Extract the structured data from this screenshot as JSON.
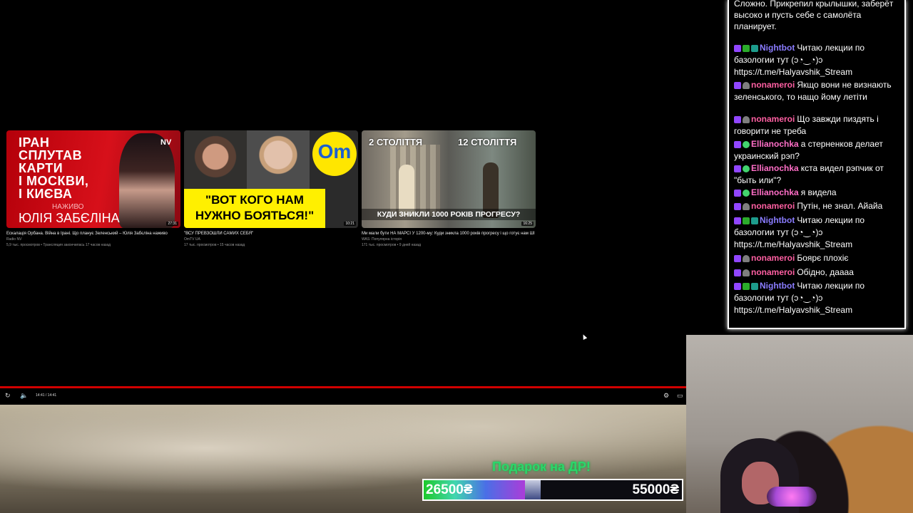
{
  "videos": [
    {
      "thumb_headline": "ІРАН\nСПЛУТАВ\nКАРТИ\nІ МОСКВИ,\nІ КИЄВА",
      "thumb_live": "НАЖИВО",
      "thumb_name": "ЮЛІЯ ЗАБЄЛІНА",
      "thumb_badge": "NV",
      "duration": "27:31",
      "title": "Ескалація Орбана. Війна в Ірані. Що планує Зеленський – Юлія Забєліна наживо",
      "channel": "Radio NV",
      "meta": "5,9 тыс. просмотров • Трансляция закончилась 17 часов назад"
    },
    {
      "thumb_logo": "Om",
      "thumb_quote": "\"ВОТ КОГО НАМ\nНУЖНО БОЯТЬСЯ!\"",
      "duration": "10:21",
      "title": "\"ВСУ ПРЕВЗОШЛИ САМИХ СЕБЯ\"",
      "channel": "OmTV UA",
      "meta": "17 тыс. просмотров • 15 часов назад"
    },
    {
      "thumb_left": "2 СТОЛІТТЯ",
      "thumb_right": "12 СТОЛІТТЯ",
      "thumb_bottom": "КУДИ ЗНИКЛИ 1000 РОКІВ ПРОГРЕСУ?",
      "duration": "16:25",
      "title": "Ми мали бути НА МАРСІ У 1200-му: Куди зникла 1000 років прогресу і що готує нам ШІ",
      "channel": "WAS: Популярна історія",
      "meta": "171 тыс. просмотров • 9 дней назад"
    }
  ],
  "player": {
    "time": "14:41 / 14:41",
    "progress_fraction": 1.0
  },
  "donation_goal": {
    "title": "Подарок на ДР!",
    "start": "26500₴",
    "end": "55000₴",
    "fill_fraction": 0.4
  },
  "chat": {
    "top_text": "Сложно. Прикрепил крылышки, заберёт высоко и пусть себе с самолёта планирует.",
    "messages": [
      {
        "user": "Nightbot",
        "color": "#8a7cff",
        "badges": [
          "twitch",
          "mod",
          "bot"
        ],
        "text": "Читаю лекции по базологии тут (ↄ◔‿◔)ↄ https://t.me/Halyavshik_Stream"
      },
      {
        "user": "nonameroi",
        "color": "#ff5fa2",
        "badges": [
          "twitch",
          "wolf"
        ],
        "text": "Якщо вони не визнають зеленського, то нащо йому летіти"
      },
      {
        "user": "nonameroi",
        "color": "#ff5fa2",
        "badges": [
          "twitch",
          "wolf"
        ],
        "text": "Що завжди пиздять і говорити не треба"
      },
      {
        "user": "Ellianochka",
        "color": "#ff6ec7",
        "badges": [
          "twitch",
          "alien"
        ],
        "text": "а стерненков делает украинский рэп?"
      },
      {
        "user": "Ellianochka",
        "color": "#ff6ec7",
        "badges": [
          "twitch",
          "alien"
        ],
        "text": "кста видел рэпчик от \"быть или\"?"
      },
      {
        "user": "Ellianochka",
        "color": "#ff6ec7",
        "badges": [
          "twitch",
          "alien"
        ],
        "text": "я видела"
      },
      {
        "user": "nonameroi",
        "color": "#ff5fa2",
        "badges": [
          "twitch",
          "wolf"
        ],
        "text": "Путін, не знал. Айайа"
      },
      {
        "user": "Nightbot",
        "color": "#8a7cff",
        "badges": [
          "twitch",
          "mod",
          "bot"
        ],
        "text": "Читаю лекции по базологии тут (ↄ◔‿◔)ↄ https://t.me/Halyavshik_Stream"
      },
      {
        "user": "nonameroi",
        "color": "#ff5fa2",
        "badges": [
          "twitch",
          "wolf"
        ],
        "text": "Боярє плохіє"
      },
      {
        "user": "nonameroi",
        "color": "#ff5fa2",
        "badges": [
          "twitch",
          "wolf"
        ],
        "text": "Обідно, дааaa"
      },
      {
        "user": "Nightbot",
        "color": "#8a7cff",
        "badges": [
          "twitch",
          "mod",
          "bot"
        ],
        "text": "Читаю лекции по базологии тут (ↄ◔‿◔)ↄ https://t.me/Halyavshik_Stream"
      }
    ]
  }
}
